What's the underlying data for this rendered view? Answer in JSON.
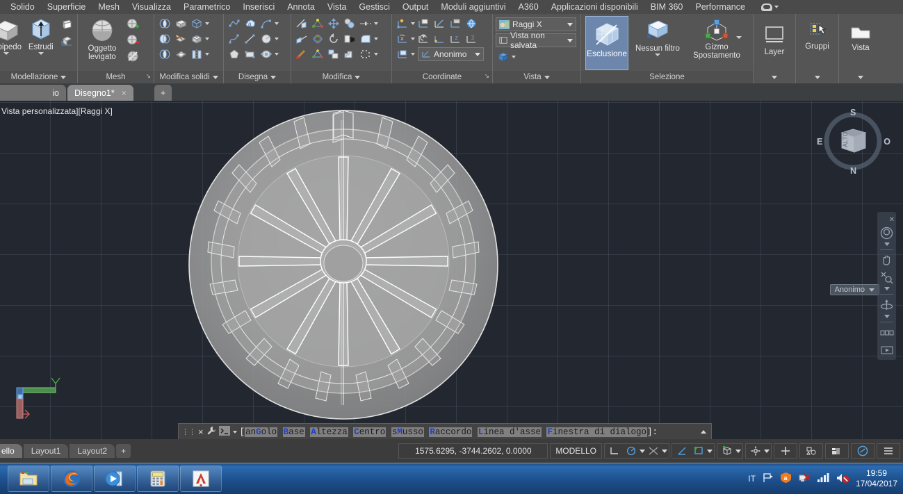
{
  "menubar": {
    "items": [
      {
        "label": "Solido"
      },
      {
        "label": "Superficie"
      },
      {
        "label": "Mesh"
      },
      {
        "label": "Visualizza"
      },
      {
        "label": "Parametrico"
      },
      {
        "label": "Inserisci"
      },
      {
        "label": "Annota"
      },
      {
        "label": "Vista"
      },
      {
        "label": "Gestisci"
      },
      {
        "label": "Output"
      },
      {
        "label": "Moduli aggiuntivi"
      },
      {
        "label": "A360"
      },
      {
        "label": "Applicazioni disponibili"
      },
      {
        "label": "BIM 360"
      },
      {
        "label": "Performance"
      }
    ],
    "cloud_icon": "cloud-icon"
  },
  "ribbon": {
    "panels": [
      {
        "title": "Modellazione",
        "big_buttons": [
          {
            "label": "lepipedo",
            "icon": "box-solid-icon",
            "has_caret": true
          },
          {
            "label": "Estrudi",
            "icon": "extrude-icon",
            "has_caret": true
          }
        ],
        "small_icons": [
          {
            "name": "press-pull-icon"
          },
          {
            "name": "solid-history-icon"
          }
        ]
      },
      {
        "title": "Mesh",
        "big_buttons": [
          {
            "label": "Oggetto levigato",
            "icon": "smooth-object-icon",
            "has_caret": false
          }
        ],
        "small_icons": [
          {
            "name": "mesh-refine-add-icon"
          },
          {
            "name": "mesh-refine-remove-icon"
          },
          {
            "name": "mesh-crease-icon"
          }
        ]
      },
      {
        "title": "Modifica solidi",
        "small_icons": [
          {
            "name": "union-icon"
          },
          {
            "name": "extrude-face-icon"
          },
          {
            "name": "solid-slice-icon"
          },
          {
            "name": "subtract-icon"
          },
          {
            "name": "taper-face-icon"
          },
          {
            "name": "imprint-icon"
          },
          {
            "name": "intersect-icon"
          },
          {
            "name": "shell-icon"
          },
          {
            "name": "separate-icon"
          }
        ]
      },
      {
        "title": "Disegna",
        "small_icons": [
          {
            "name": "polyline-icon"
          },
          {
            "name": "revision-cloud-icon"
          },
          {
            "name": "arc-icon"
          },
          {
            "name": "spline-icon"
          },
          {
            "name": "line-icon"
          },
          {
            "name": "circle-icon"
          },
          {
            "name": "polygon-icon"
          },
          {
            "name": "rectangle-icon"
          },
          {
            "name": "hatch-icon"
          }
        ]
      },
      {
        "title": "Modifica",
        "small_icons": [
          {
            "name": "trim-icon"
          },
          {
            "name": "scale-icon"
          },
          {
            "name": "move-icon"
          },
          {
            "name": "copy-icon"
          },
          {
            "name": "stretch-icon"
          },
          {
            "name": "extend-icon"
          },
          {
            "name": "3d-rotate-icon"
          },
          {
            "name": "rotate-icon"
          },
          {
            "name": "mirror-icon"
          },
          {
            "name": "fillet-icon"
          },
          {
            "name": "match-properties-icon"
          },
          {
            "name": "3d-align-icon"
          },
          {
            "name": "array-icon"
          },
          {
            "name": "offset-icon"
          },
          {
            "name": "explode-icon"
          }
        ]
      },
      {
        "title": "Coordinate",
        "small_icons": [
          {
            "name": "ucs-origin-icon"
          },
          {
            "name": "ucs-named-icon"
          },
          {
            "name": "ucs-face-icon"
          },
          {
            "name": "ucs-object-icon"
          },
          {
            "name": "ucs-world-icon"
          },
          {
            "name": "ucs-x-icon"
          },
          {
            "name": "ucs-previous-icon"
          },
          {
            "name": "ucs-y-icon"
          },
          {
            "name": "ucs-z-icon"
          },
          {
            "name": "ucs-3point-icon"
          },
          {
            "name": "ucs-view-icon"
          }
        ],
        "combo": {
          "label": "Anonimo",
          "icon": "ucs-icon"
        },
        "dialog_launcher": true
      },
      {
        "title": "Vista",
        "combos": [
          {
            "label": "Raggi X",
            "icon": "visual-style-icon"
          },
          {
            "label": "Vista non salvata",
            "icon": "named-view-icon"
          }
        ],
        "small_icons": [
          {
            "name": "viewport-config-icon"
          }
        ]
      },
      {
        "title": "Selezione",
        "big_buttons": [
          {
            "label": "Esclusione",
            "icon": "subobject-filter-icon",
            "active": true,
            "has_caret": false
          },
          {
            "label": "Nessun filtro",
            "icon": "no-filter-icon",
            "has_caret": true
          },
          {
            "label": "Gizmo Spostamento",
            "icon": "move-gizmo-icon",
            "has_caret": true
          }
        ]
      },
      {
        "title": "",
        "big_buttons": [
          {
            "label": "Layer",
            "icon": "layer-icon",
            "has_caret": true
          }
        ]
      },
      {
        "title": "",
        "big_buttons": [
          {
            "label": "Gruppi",
            "icon": "group-icon",
            "has_caret": true
          }
        ]
      },
      {
        "title": "",
        "big_buttons": [
          {
            "label": "Vista",
            "icon": "view-icon",
            "has_caret": true
          }
        ]
      }
    ]
  },
  "file_tabs": {
    "left_partial": "io",
    "tabs": [
      {
        "label": "Disegno1*",
        "active": true,
        "close": "×"
      }
    ],
    "add_label": "+"
  },
  "canvas": {
    "viewport_label": "Vista personalizzata][Raggi X]",
    "navcube": {
      "top_face": "ALTO",
      "compass": {
        "north": "N",
        "south": "S",
        "east": "E",
        "west": "O"
      }
    },
    "anonymous_ucs_pill": "Anonimo",
    "nav_tools": [
      {
        "name": "steering-wheel-icon"
      },
      {
        "name": "pan-hand-icon"
      },
      {
        "name": "zoom-extents-icon"
      },
      {
        "name": "orbit-icon"
      },
      {
        "name": "showmotion-icon"
      }
    ],
    "model": {
      "name": "flywheel-3d-model",
      "spokes": 12,
      "rim_vanes": 24
    }
  },
  "command_line": {
    "prompt_prefix": "[",
    "prompt_suffix": "]:",
    "options": [
      {
        "pre": "an",
        "hot": "G",
        "post": "olo"
      },
      {
        "pre": "",
        "hot": "B",
        "post": "ase"
      },
      {
        "pre": "",
        "hot": "A",
        "post": "ltezza"
      },
      {
        "pre": "",
        "hot": "C",
        "post": "entro"
      },
      {
        "pre": "s",
        "hot": "M",
        "post": "usso"
      },
      {
        "pre": "",
        "hot": "R",
        "post": "accordo"
      },
      {
        "pre": "",
        "hot": "L",
        "post": "inea d'asse"
      },
      {
        "pre": "",
        "hot": "F",
        "post": "inestra di dialogo"
      }
    ],
    "icons": {
      "close": "×",
      "settings": "wrench-icon",
      "history": "chevron-up-icon",
      "cmd": "command-prompt-icon"
    }
  },
  "statusbar": {
    "layout_tabs": [
      {
        "label": "ello",
        "active": true
      },
      {
        "label": "Layout1"
      },
      {
        "label": "Layout2"
      }
    ],
    "add_layout": "+",
    "coordinates": "1575.6295, -3744.2602, 0.0000",
    "space_mode": "MODELLO",
    "right_icons": [
      {
        "name": "ortho-mode-icon"
      },
      {
        "name": "polar-tracking-icon"
      },
      {
        "name": "osnap-icon"
      },
      {
        "name": "otrack-icon"
      },
      {
        "name": "lineweight-icon"
      },
      {
        "name": "transparency-icon"
      },
      {
        "name": "selection-cycling-icon"
      },
      {
        "name": "3d-osnap-icon"
      },
      {
        "name": "annotation-settings-icon"
      },
      {
        "name": "workspace-gear-icon"
      },
      {
        "name": "customization-plus-icon"
      },
      {
        "name": "isolate-objects-icon"
      },
      {
        "name": "hardware-accel-icon"
      },
      {
        "name": "clean-screen-icon"
      },
      {
        "name": "menu-hamburger-icon"
      }
    ]
  },
  "taskbar": {
    "apps": [
      {
        "name": "file-explorer-icon"
      },
      {
        "name": "firefox-icon"
      },
      {
        "name": "media-player-icon"
      },
      {
        "name": "calculator-icon"
      },
      {
        "name": "autocad-icon"
      }
    ],
    "tray": {
      "language": "IT",
      "icons": [
        {
          "name": "action-center-flag-icon"
        },
        {
          "name": "avast-antivirus-icon"
        },
        {
          "name": "network-disconnected-icon"
        },
        {
          "name": "signal-bars-icon"
        },
        {
          "name": "volume-muted-icon"
        }
      ],
      "time": "19:59",
      "date": "17/04/2017"
    }
  },
  "colors": {
    "menu_bg": "#4a4a4a",
    "ribbon_bg": "#555555",
    "canvas_bg": "#232830",
    "accent_blue": "#6d86ac",
    "taskbar_blue": "#2b6bb0",
    "model_fill": "#9a9a9a"
  }
}
